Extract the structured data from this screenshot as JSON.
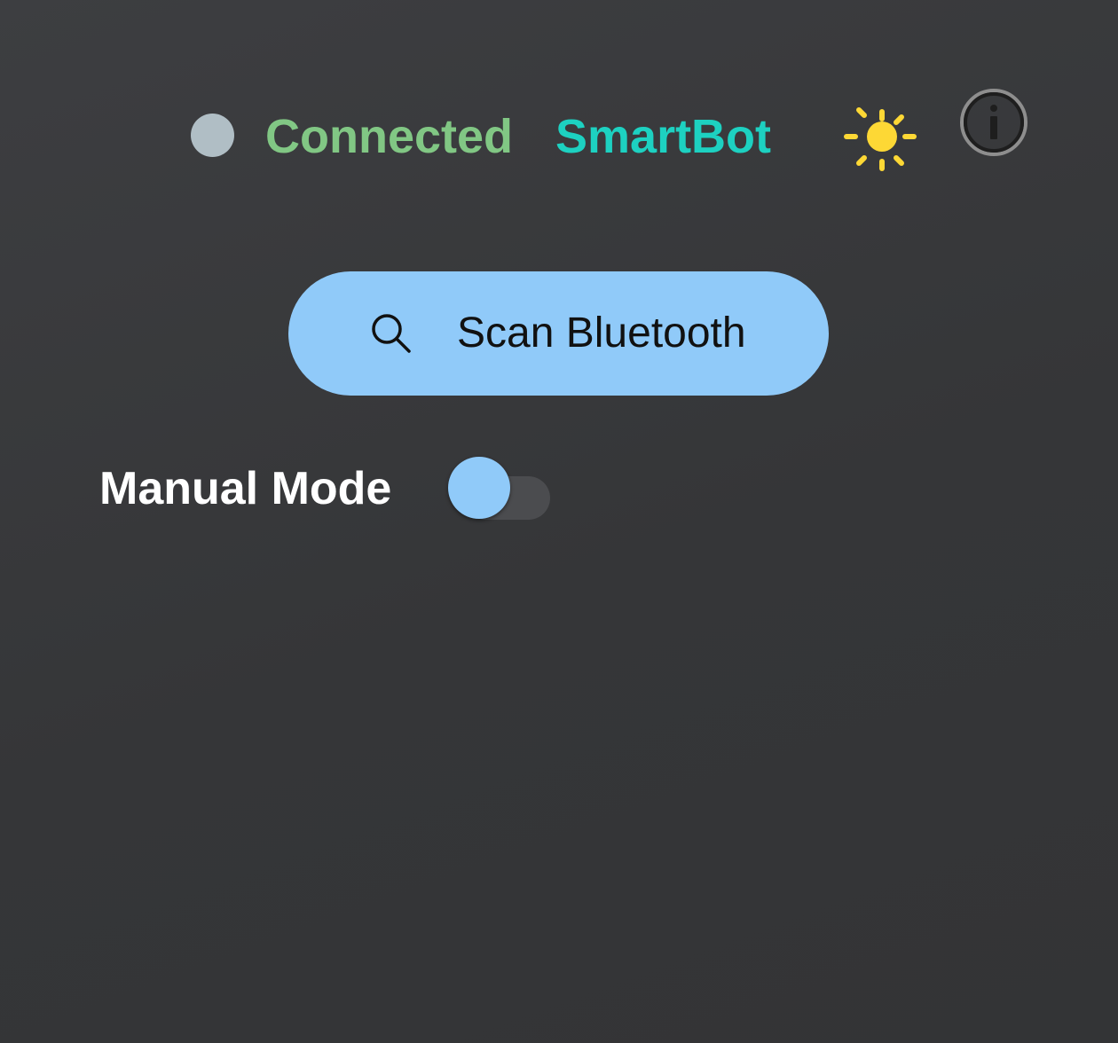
{
  "header": {
    "connection_status": "Connected",
    "device_name": "SmartBot",
    "status_dot_color": "#b0bec5",
    "status_text_color": "#81c784",
    "device_name_color": "#1dd1c1",
    "theme_icon": "sun-icon",
    "info_icon": "info-icon"
  },
  "scan": {
    "label": "Scan Bluetooth",
    "icon": "search-icon",
    "background_color": "#90caf9"
  },
  "manual_mode": {
    "label": "Manual Mode",
    "enabled": false,
    "thumb_color": "#90caf9"
  }
}
